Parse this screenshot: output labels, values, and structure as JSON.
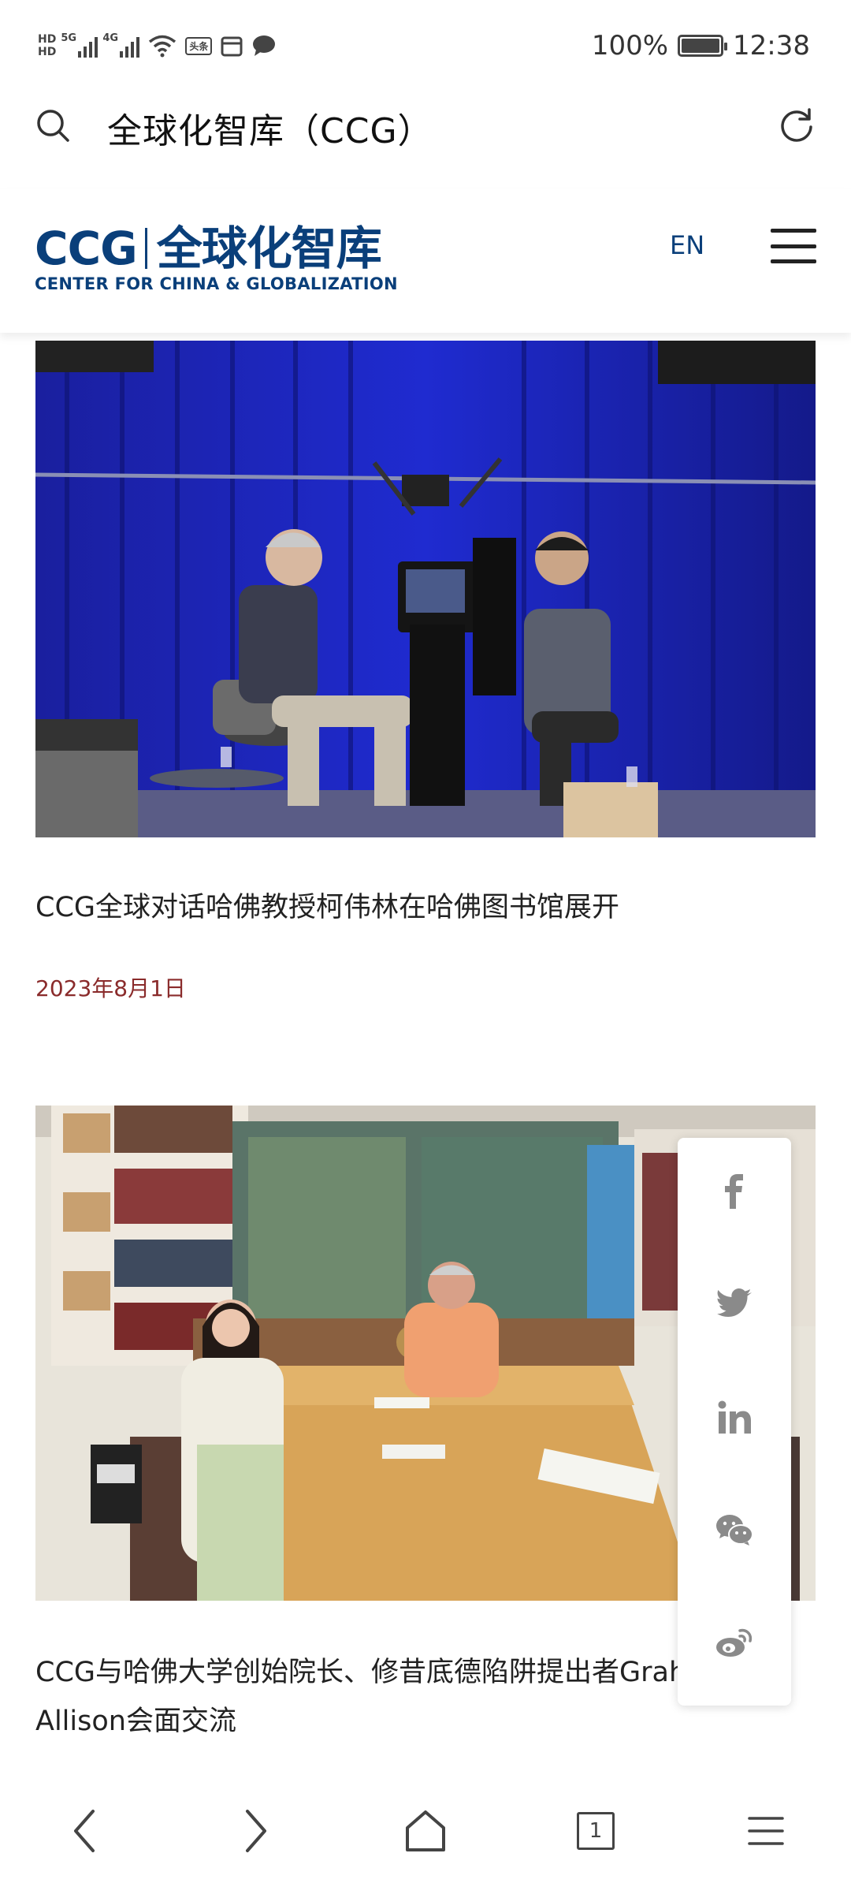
{
  "status_bar": {
    "hd1": "HD",
    "hd2": "HD",
    "net1": "5G",
    "net2": "4G",
    "app_badge": "头条",
    "battery_text": "100%",
    "time": "12:38"
  },
  "browser": {
    "page_title": "全球化智库（CCG）"
  },
  "site": {
    "logo_line1_latin": "CCG",
    "logo_line1_cn": "全球化智库",
    "logo_line2": "CENTER FOR CHINA & GLOBALIZATION",
    "lang_label": "EN",
    "brand_color": "#0a3f7a"
  },
  "articles": [
    {
      "title": "CCG全球对话哈佛教授柯伟林在哈佛图书馆展开",
      "date": "2023年8月1日"
    },
    {
      "title": "CCG与哈佛大学创始院长、修昔底德陷阱提出者Graham Allison会面交流"
    }
  ],
  "share": {
    "items": [
      "facebook-icon",
      "twitter-icon",
      "linkedin-icon",
      "wechat-icon",
      "weibo-icon"
    ]
  },
  "nav": {
    "tab_count": "1"
  }
}
